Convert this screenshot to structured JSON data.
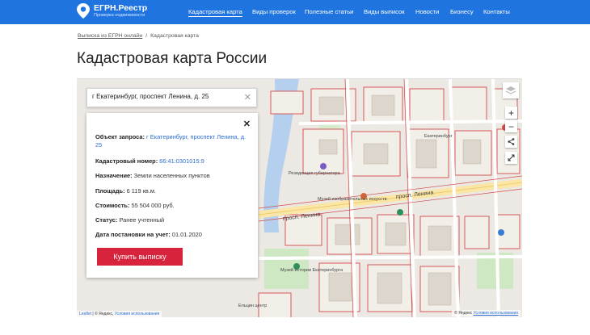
{
  "header": {
    "logo_title": "ЕГРН.Реестр",
    "logo_subtitle": "Проверка недвижимости",
    "nav": [
      "Кадастровая карта",
      "Виды проверок",
      "Полезные статьи",
      "Виды выписок",
      "Новости",
      "Бизнесу",
      "Контакты"
    ],
    "active_index": 0,
    "bg_color": "#1f74e0"
  },
  "breadcrumb": {
    "link": "Выписка из ЕГРН онлайн",
    "separator": "/",
    "current": "Кадастровая карта"
  },
  "page_title": "Кадастровая карта России",
  "map": {
    "search_value": "г Екатеринбург, проспект Ленина, д. 25",
    "street_labels": [
      "просп. Ленина",
      "просп. Ленина"
    ],
    "place_labels": [
      "Резиденция губернатора",
      "Музей изобразительных искусств",
      "Екатеринбург",
      "Музей истории Екатеринбурга",
      "Ельцин центр"
    ],
    "controls": {
      "zoom_in": "+",
      "zoom_out": "−"
    },
    "attribution": {
      "leaflet": "Leaflet",
      "sep": " | © ",
      "yandex": "Яндекс",
      "terms": "Условия использования"
    },
    "copyright": {
      "text": "© Яндекс",
      "terms": "Условия использования"
    }
  },
  "info_card": {
    "object_label": "Объект запроса:",
    "object_value": "г Екатеринбург, проспект Ленина, д. 25",
    "cadastral_label": "Кадастровый номер:",
    "cadastral_value": "66:41:0301015:9",
    "purpose_label": "Назначение:",
    "purpose_value": "Земли населенных пунктов",
    "area_label": "Площадь:",
    "area_value": "6 119 кв.м.",
    "cost_label": "Стоимость:",
    "cost_value": "55 504 000 руб.",
    "status_label": "Статус:",
    "status_value": "Ранее учтенный",
    "date_label": "Дата постановки на учет:",
    "date_value": "01.01.2020",
    "buy_button": "Купить выписку"
  }
}
